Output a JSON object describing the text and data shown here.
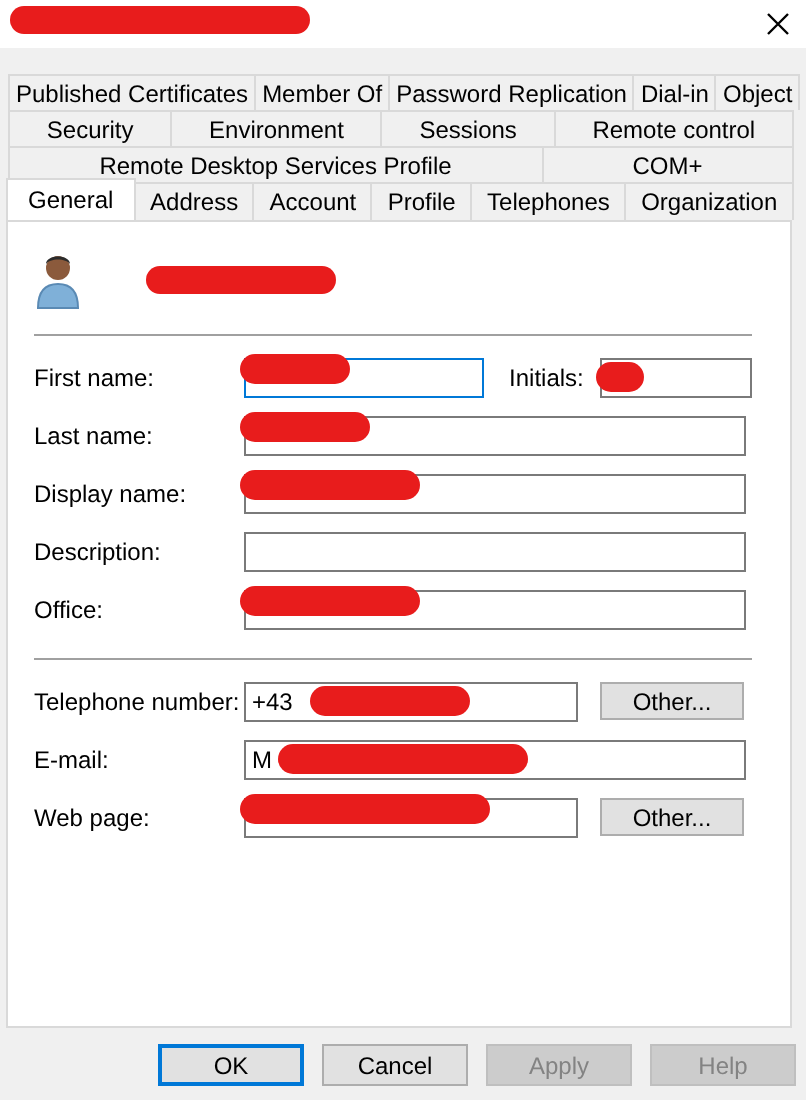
{
  "window": {
    "title_redacted": true
  },
  "tab_rows": [
    [
      {
        "label": "Published Certificates",
        "selected": false
      },
      {
        "label": "Member Of",
        "selected": false
      },
      {
        "label": "Password Replication",
        "selected": false
      },
      {
        "label": "Dial-in",
        "selected": false
      },
      {
        "label": "Object",
        "selected": false
      }
    ],
    [
      {
        "label": "Security",
        "selected": false
      },
      {
        "label": "Environment",
        "selected": false
      },
      {
        "label": "Sessions",
        "selected": false
      },
      {
        "label": "Remote control",
        "selected": false
      }
    ],
    [
      {
        "label": "Remote Desktop Services Profile",
        "selected": false
      },
      {
        "label": "COM+",
        "selected": false
      }
    ],
    [
      {
        "label": "General",
        "selected": true
      },
      {
        "label": "Address",
        "selected": false
      },
      {
        "label": "Account",
        "selected": false
      },
      {
        "label": "Profile",
        "selected": false
      },
      {
        "label": "Telephones",
        "selected": false
      },
      {
        "label": "Organization",
        "selected": false
      }
    ]
  ],
  "account_name": {
    "redacted": true
  },
  "groups": [
    [
      {
        "label": "First name:",
        "redacted": true,
        "focused": true,
        "initials": {
          "label": "Initials:",
          "redacted": true
        }
      },
      {
        "label": "Last name:",
        "redacted": true,
        "focused": false
      },
      {
        "label": "Display name:",
        "redacted": true,
        "focused": false
      },
      {
        "label": "Description:",
        "redacted": false,
        "focused": false
      },
      {
        "label": "Office:",
        "redacted": true,
        "focused": false
      }
    ],
    [
      {
        "label": "Telephone number:",
        "value": "+43",
        "redacted": true,
        "focused": false,
        "button": "Other..."
      },
      {
        "label": "E-mail:",
        "value": "M",
        "redacted": true,
        "focused": false
      },
      {
        "label": "Web page:",
        "redacted": true,
        "focused": false,
        "button": "Other..."
      }
    ]
  ],
  "buttons": [
    {
      "label": "OK",
      "default": true,
      "disabled": false
    },
    {
      "label": "Cancel",
      "default": false,
      "disabled": false
    },
    {
      "label": "Apply",
      "default": false,
      "disabled": true
    },
    {
      "label": "Help",
      "default": false,
      "disabled": true
    }
  ]
}
